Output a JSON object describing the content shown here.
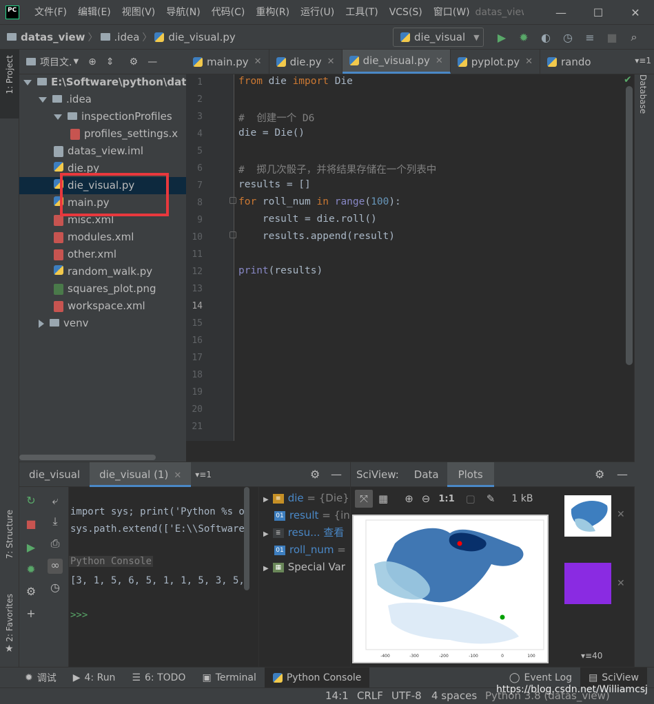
{
  "app": {
    "logo_text": "PC",
    "menu": [
      "文件(F)",
      "编辑(E)",
      "视图(V)",
      "导航(N)",
      "代码(C)",
      "重构(R)",
      "运行(U)",
      "工具(T)",
      "VCS(S)",
      "窗口(W)"
    ],
    "window_title": "datas_view",
    "win_controls": [
      "—",
      "☐",
      "✕"
    ]
  },
  "nav": {
    "crumbs": [
      "datas_view",
      ".idea",
      "die_visual.py"
    ],
    "run_config": "die_visual"
  },
  "left_stripe": {
    "project_tab": "1: Project",
    "structure_tab": "7: Structure",
    "favorites_tab": "2: Favorites"
  },
  "right_stripe": {
    "database_tab": "Database"
  },
  "project": {
    "header": "项目文.",
    "tree": [
      {
        "label": "E:\\Software\\python\\datas",
        "type": "folder",
        "indent": 0,
        "expanded": true
      },
      {
        "label": ".idea",
        "type": "folder",
        "indent": 1,
        "expanded": true
      },
      {
        "label": "inspectionProfiles",
        "type": "folder",
        "indent": 2,
        "expanded": true
      },
      {
        "label": "profiles_settings.x",
        "type": "xml",
        "indent": 3
      },
      {
        "label": "datas_view.iml",
        "type": "iml",
        "indent": 2
      },
      {
        "label": "die.py",
        "type": "py",
        "indent": 2
      },
      {
        "label": "die_visual.py",
        "type": "py",
        "indent": 2,
        "selected": true
      },
      {
        "label": "main.py",
        "type": "py",
        "indent": 2
      },
      {
        "label": "misc.xml",
        "type": "xml",
        "indent": 2
      },
      {
        "label": "modules.xml",
        "type": "xml",
        "indent": 2
      },
      {
        "label": "other.xml",
        "type": "xml",
        "indent": 2
      },
      {
        "label": "random_walk.py",
        "type": "py",
        "indent": 2
      },
      {
        "label": "squares_plot.png",
        "type": "png",
        "indent": 2
      },
      {
        "label": "workspace.xml",
        "type": "xml",
        "indent": 2
      },
      {
        "label": "venv",
        "type": "folder",
        "indent": 1,
        "expanded": false
      }
    ]
  },
  "editor": {
    "tabs": [
      {
        "label": "main.py",
        "active": false
      },
      {
        "label": "die.py",
        "active": false
      },
      {
        "label": "die_visual.py",
        "active": true
      },
      {
        "label": "pyplot.py",
        "active": false
      },
      {
        "label": "rando",
        "active": false
      }
    ],
    "tab_overflow": "≡1",
    "line_numbers": [
      "1",
      "2",
      "3",
      "4",
      "5",
      "6",
      "7",
      "8",
      "9",
      "10",
      "11",
      "12",
      "13",
      "14",
      "15",
      "16",
      "17",
      "18",
      "19",
      "20",
      "21"
    ],
    "code": {
      "l1": {
        "a": "from",
        "b": " die ",
        "c": "import",
        "d": " Die"
      },
      "l3": "#  创建一个 D6",
      "l4": "die = Die()",
      "l6": "#  掷几次骰子，并将结果存储在一个列表中",
      "l7": "results = []",
      "l8": {
        "a": "for",
        "b": " roll_num ",
        "c": "in",
        "d": " ",
        "e": "range",
        "f": "(",
        "g": "100",
        "h": "):"
      },
      "l9": "    result = die.roll()",
      "l10": "    results.append(result)",
      "l12": {
        "a": "print",
        "b": "(results)"
      }
    }
  },
  "console": {
    "tabs": [
      "die_visual",
      "die_visual (1)"
    ],
    "tab_overflow": "≡1",
    "lines": [
      "import sys; print('Python %s o",
      "sys.path.extend(['E:\\\\Software",
      "Python Console",
      "[3, 1, 5, 6, 5, 1, 1, 5, 3, 5,",
      ">>>"
    ],
    "variables": [
      {
        "name": "die",
        "value": "= {Die}",
        "icon": "list"
      },
      {
        "name": "result",
        "value": "= {int}",
        "icon": "01"
      },
      {
        "name": "resu...",
        "value": "查看",
        "icon": "list123"
      },
      {
        "name": "roll_num",
        "value": "=",
        "icon": "01"
      },
      {
        "name": "Special Var",
        "value": "",
        "icon": "grid"
      }
    ]
  },
  "sciview": {
    "title": "SciView:",
    "tabs": [
      "Data",
      "Plots"
    ],
    "active_tab": "Plots",
    "size_label": "1 kB",
    "zoom_label": "1:1",
    "thumb_count": "40",
    "x_ticks": [
      "-400",
      "-300",
      "-200",
      "-100",
      "0",
      "100"
    ]
  },
  "bottom_tools": [
    {
      "label": "调试",
      "icon": "bug-icon"
    },
    {
      "label": "4: Run",
      "icon": "run-icon"
    },
    {
      "label": "6: TODO",
      "icon": "todo-icon"
    },
    {
      "label": "Terminal",
      "icon": "terminal-icon"
    },
    {
      "label": "Python Console",
      "icon": "python-icon",
      "active": true
    },
    {
      "label": "Event Log",
      "icon": "event-log-icon"
    },
    {
      "label": "SciView",
      "icon": "sciview-icon"
    }
  ],
  "status": {
    "position": "14:1",
    "line_sep": "CRLF",
    "encoding": "UTF-8",
    "indent": "4 spaces",
    "interpreter": "Python 3.8 (datas_view)",
    "watermark": "https://blog.csdn.net/Williamcsj"
  },
  "colors": {
    "accent": "#4a88c7",
    "highlight_box": "#e8383d",
    "keyword": "#cc7832",
    "comment": "#808080",
    "builtin": "#8888c6",
    "number": "#6897bb"
  }
}
